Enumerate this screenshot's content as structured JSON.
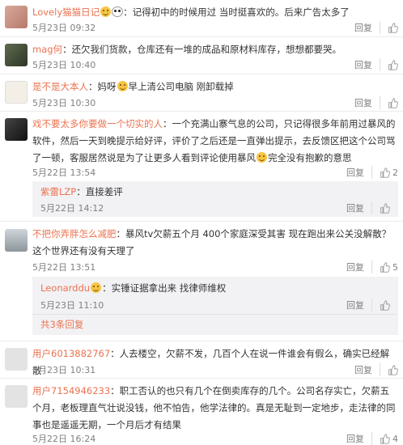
{
  "comments": [
    {
      "user": "Lovely猫猫日记",
      "text": "记得初中的时候用过 当时挺喜欢的。后来广告太多了",
      "time": "5月23日 09:32",
      "reply": "回复",
      "likes": "",
      "likeColor": "#999999"
    },
    {
      "user": "mag何",
      "text": "还欠我们货款，仓库还有一堆的成品和原材料库存，想想都要哭。",
      "time": "5月23日 10:40",
      "reply": "回复",
      "likes": "",
      "likeColor": "#999999"
    },
    {
      "user": "是不是大本人",
      "text": "妈呀",
      "text2": "早上清公司电脑 刚卸载掉",
      "time": "5月23日 10:30",
      "reply": "回复",
      "likes": "",
      "likeColor": "#999999"
    },
    {
      "user": "戏不要太多你要做一个切实的人",
      "text": "一个充满山寨气息的公司，只记得很多年前用过暴风的软件，然后一天到晚提示给好评，评价了之后还是一直弹出提示，去反馈区把这个公司骂了一顿，客服居然说是为了让更多人看到评论使用暴风",
      "text2": "完全没有抱歉的意思",
      "time": "5月22日 13:54",
      "reply": "回复",
      "likes": "2",
      "likeColor": "#999999"
    },
    {
      "user": "紫雷LZP",
      "text": "直接差评",
      "time": "5月22日 14:12",
      "reply": "回复",
      "likes": "",
      "likeColor": "#999999"
    },
    {
      "user": "不把你弄胖怎么减肥",
      "text": "暴风tv欠薪五个月 400个家庭深受其害 现在跑出来公关没解散？这个世界还有没有天理了",
      "time": "5月22日 13:51",
      "reply": "回复",
      "likes": "5",
      "likeColor": "#999999"
    },
    {
      "user": "Leonarddu",
      "text": "实锤证据拿出来 找律师维权",
      "time": "5月23日 11:10",
      "reply": "回复",
      "likes": "",
      "likeColor": "#999999",
      "more": "共3条回复"
    },
    {
      "user": "用户6013882767",
      "text": "人去楼空，欠薪不发，几百个人在说一件谁会有假么，确实已经解散",
      "time": "5月23日 10:31",
      "reply": "回复",
      "likes": "",
      "likeColor": "#999999"
    },
    {
      "user": "用户7154946233",
      "text": "职工否认的也只有几个在倒卖库存的几个。公司名存实亡，欠薪五个月，老板理直气壮说没钱，他不怕告，他学法律的。真是无耻到一定地步，走法律的同事也是遥遥无期，一个月后才有结果",
      "time": "5月22日 16:24",
      "reply": "回复",
      "likes": "4",
      "likeColor": "#999999"
    }
  ],
  "colors": {
    "username": "#eb7350",
    "text": "#333333",
    "meta": "#808080"
  }
}
